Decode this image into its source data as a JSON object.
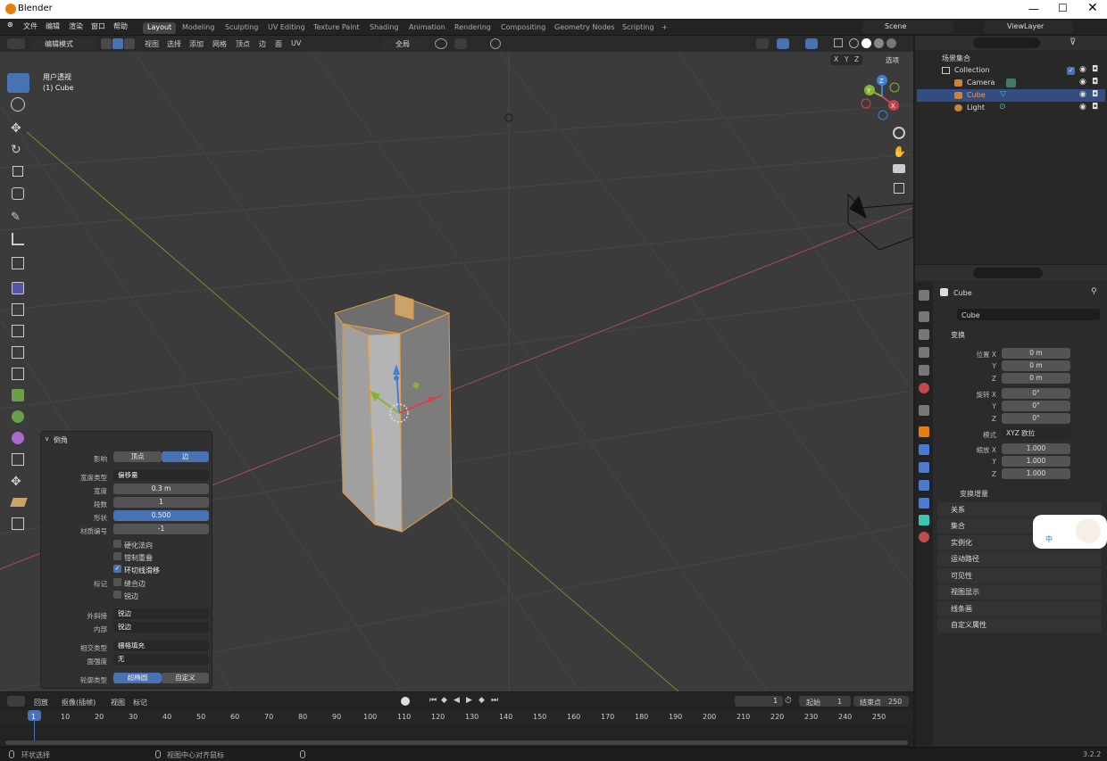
{
  "window": {
    "title": "Blender"
  },
  "menu": [
    "文件",
    "编辑",
    "渲染",
    "窗口",
    "帮助"
  ],
  "workspace_tabs": [
    "Layout",
    "Modeling",
    "Sculpting",
    "UV Editing",
    "Texture Paint",
    "Shading",
    "Animation",
    "Rendering",
    "Compositing",
    "Geometry Nodes",
    "Scripting",
    "+"
  ],
  "scene": {
    "label": "Scene",
    "view_layer": "ViewLayer"
  },
  "viewport_header": {
    "mode": "编辑模式",
    "menus": [
      "视图",
      "选择",
      "添加",
      "网格",
      "顶点",
      "边",
      "面",
      "UV"
    ],
    "transform_orientation": "全局",
    "options": "选项",
    "axes": [
      "X",
      "Y",
      "Z"
    ]
  },
  "viewport": {
    "view_name": "用户透视",
    "object_name": "(1) Cube",
    "gizmo": {
      "x": "X",
      "y": "Y",
      "z": "Z"
    }
  },
  "bevel_panel": {
    "title": "倒角",
    "affect_label": "影响",
    "affect_options": [
      "顶点",
      "边"
    ],
    "width_type_label": "宽度类型",
    "width_type": "偏移量",
    "width_label": "宽度",
    "width": "0.3 m",
    "segments_label": "段数",
    "segments": "1",
    "shape_label": "形状",
    "shape": "0.500",
    "material_label": "材质编号",
    "material": "-1",
    "harden_normals": "硬化法向",
    "clamp_overlap": "钳制重叠",
    "loop_slide": "环切线滑移",
    "mark_label": "标记",
    "mark_seam": "缝合边",
    "mark_sharp": "锐边",
    "outer_miter_label": "外斜接",
    "outer_miter": "锐边",
    "inner_miter_label": "内部",
    "inner_miter": "锐边",
    "intersection_label": "相交类型",
    "intersection": "栅格填充",
    "face_strength_label": "面强度",
    "face_strength": "无",
    "profile_label": "轮廓类型",
    "profile_options": [
      "超椭圆",
      "自定义"
    ]
  },
  "outliner": {
    "root": "场景集合",
    "items": [
      {
        "name": "Collection",
        "level": 1
      },
      {
        "name": "Camera",
        "level": 2
      },
      {
        "name": "Cube",
        "level": 2
      },
      {
        "name": "Light",
        "level": 2
      }
    ]
  },
  "properties": {
    "object_name": "Cube",
    "data_name": "Cube",
    "transform_title": "变换",
    "location_label": "位置 X",
    "loc": [
      "0 m",
      "0 m",
      "0 m"
    ],
    "rotation_label": "旋转 X",
    "rot": [
      "0°",
      "0°",
      "0°"
    ],
    "mode_label": "模式",
    "rotation_mode": "XYZ 欧拉",
    "scale_label": "缩放 X",
    "scale": [
      "1.000",
      "1.000",
      "1.000"
    ],
    "y": "Y",
    "z": "Z",
    "delta_transform": "变换增量",
    "sections": [
      "关系",
      "集合",
      "实例化",
      "运动路径",
      "可见性",
      "视图显示",
      "线条画",
      "自定义属性"
    ]
  },
  "timeline": {
    "menus": [
      "回放",
      "抠像(插帧)",
      "视图",
      "标记"
    ],
    "current_frame": "1",
    "start_label": "起始",
    "start": "1",
    "end_label": "结束点",
    "end": "250",
    "ticks": [
      "1",
      "10",
      "20",
      "30",
      "40",
      "50",
      "60",
      "70",
      "80",
      "90",
      "100",
      "110",
      "120",
      "130",
      "140",
      "150",
      "160",
      "170",
      "180",
      "190",
      "200",
      "210",
      "220",
      "230",
      "240",
      "250"
    ]
  },
  "statusbar": {
    "left": "环状选择",
    "middle": "视图中心对齐鼠标",
    "version": "3.2.2"
  },
  "ime": {
    "label": "中"
  },
  "colors": {
    "accent": "#4772b3",
    "selected_edge": "#e89a3c",
    "x_axis": "#d4414f",
    "y_axis": "#86b430",
    "z_axis": "#3b82d8"
  }
}
